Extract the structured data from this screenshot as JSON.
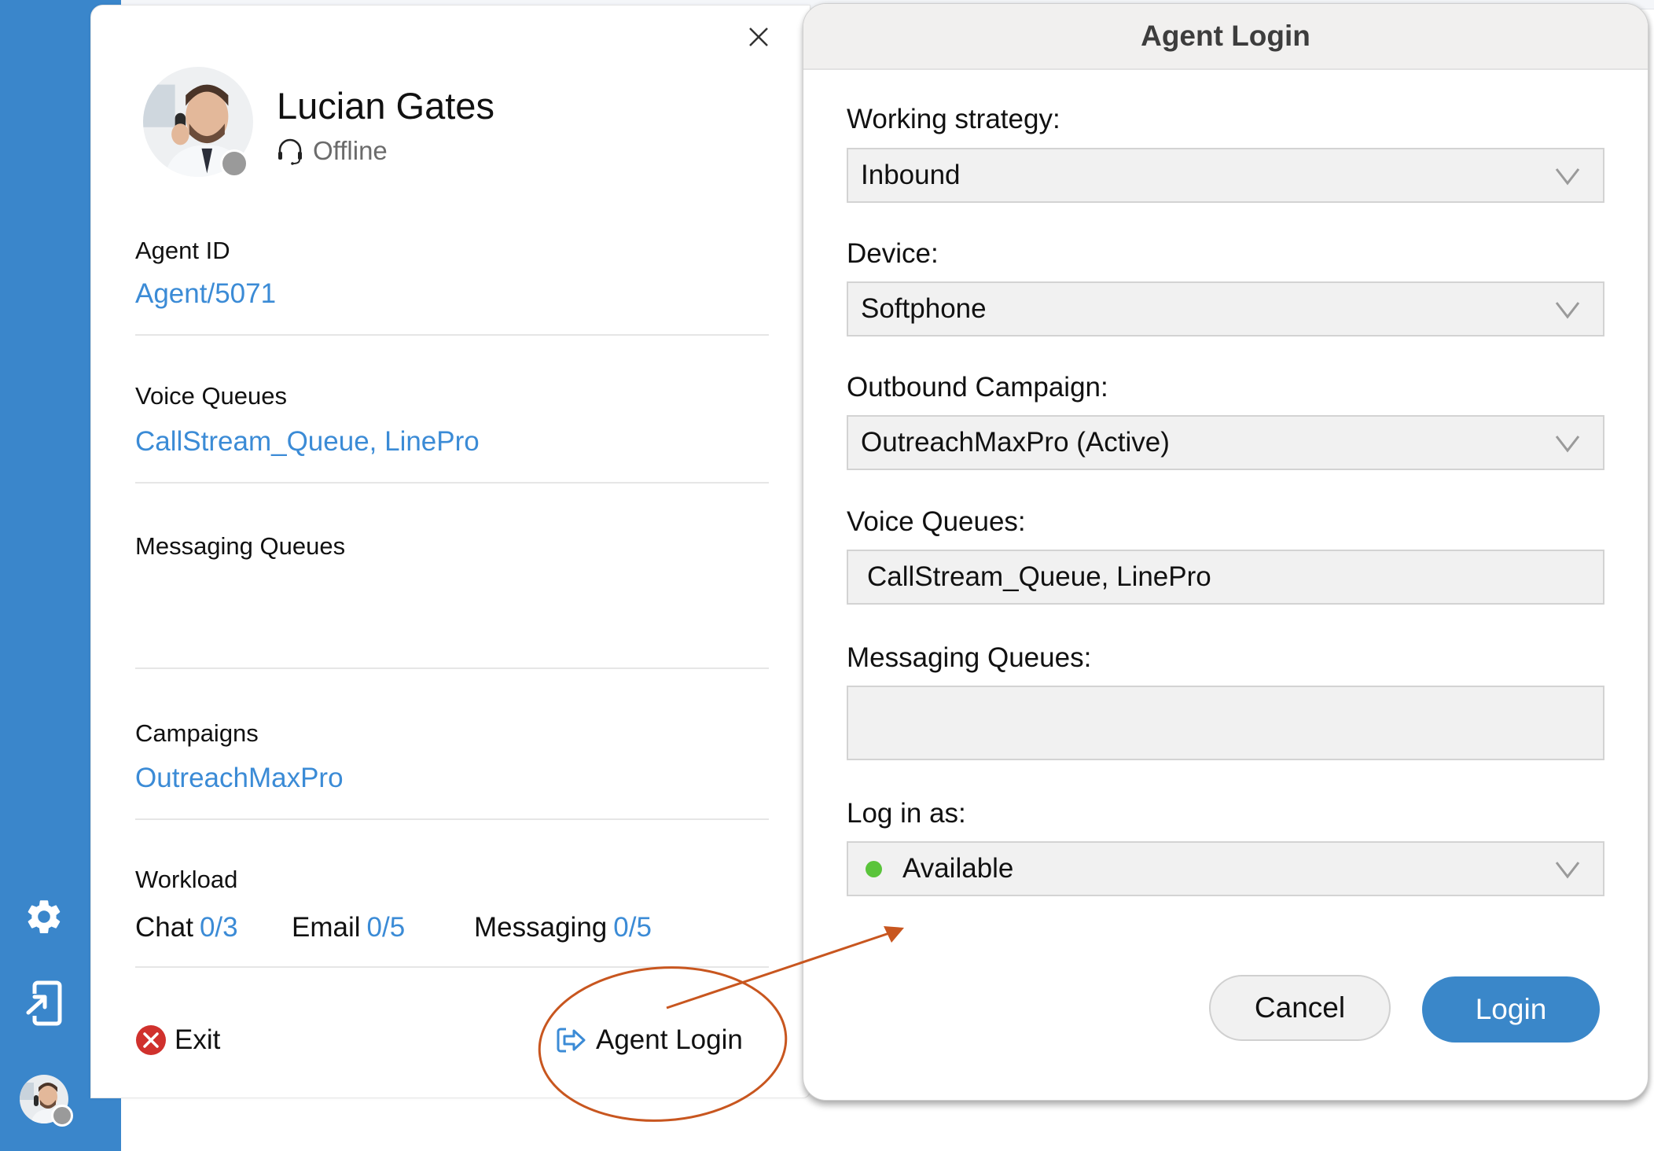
{
  "sidebar": {
    "items": [
      {
        "name": "settings",
        "icon": "gear-icon"
      },
      {
        "name": "login",
        "icon": "login-device-icon"
      }
    ],
    "avatar_status": "offline"
  },
  "agent_panel": {
    "name": "Lucian Gates",
    "status": "Offline",
    "status_icon": "headset-icon",
    "close_icon": "close-icon",
    "agent_id_label": "Agent ID",
    "agent_id_value": "Agent/5071",
    "voice_queues_label": "Voice Queues",
    "voice_queues_value": "CallStream_Queue, LinePro",
    "messaging_queues_label": "Messaging Queues",
    "messaging_queues_value": "",
    "campaigns_label": "Campaigns",
    "campaigns_value": "OutreachMaxPro",
    "workload": {
      "label": "Workload",
      "items": [
        {
          "label": "Chat",
          "value": "0/3"
        },
        {
          "label": "Email",
          "value": "0/5"
        },
        {
          "label": "Messaging",
          "value": "0/5"
        }
      ]
    },
    "exit_label": "Exit",
    "agent_login_label": "Agent Login"
  },
  "dialog": {
    "title": "Agent Login",
    "fields": {
      "working_strategy": {
        "label": "Working strategy:",
        "value": "Inbound"
      },
      "device": {
        "label": "Device:",
        "value": "Softphone"
      },
      "outbound_campaign": {
        "label": "Outbound Campaign:",
        "value": "OutreachMaxPro (Active)"
      },
      "voice_queues": {
        "label": "Voice Queues:",
        "value": "CallStream_Queue, LinePro"
      },
      "messaging_queues": {
        "label": "Messaging Queues:",
        "value": ""
      },
      "log_in_as": {
        "label": "Log in as:",
        "value": "Available",
        "status_color": "#5ac43b"
      }
    },
    "cancel_label": "Cancel",
    "login_label": "Login"
  },
  "colors": {
    "sidebar": "#3a86cb",
    "link": "#3b8bd6",
    "primary_button": "#3a87c9",
    "annotation": "#c8561f",
    "exit_icon": "#d0312d"
  }
}
